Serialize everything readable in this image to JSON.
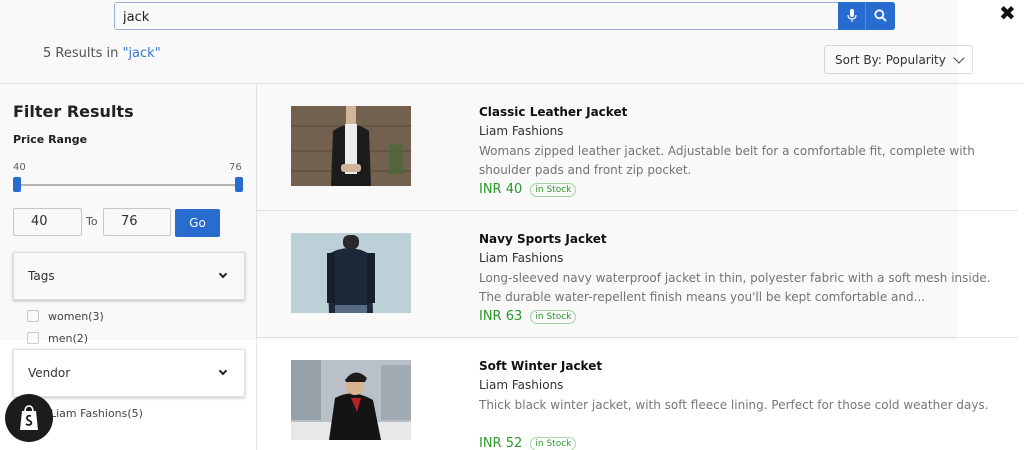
{
  "search": {
    "value": "jack",
    "mic_icon": "microphone-icon",
    "search_icon": "search-icon",
    "close_icon": "close-icon"
  },
  "results_summary": {
    "count_text": "5 Results in",
    "query_text": "\"jack\""
  },
  "sort": {
    "label": "Sort By: Popularity"
  },
  "filters": {
    "title": "Filter Results",
    "price_range": {
      "label": "Price Range",
      "min_label": "40",
      "max_label": "76",
      "min_value": "40",
      "max_value": "76",
      "to_label": "To",
      "go_label": "Go"
    },
    "tags": {
      "label": "Tags",
      "options": [
        {
          "label": "women(3)"
        },
        {
          "label": "men(2)"
        }
      ]
    },
    "vendor": {
      "label": "Vendor",
      "options": [
        {
          "label": "Liam Fashions(5)"
        }
      ]
    }
  },
  "products": [
    {
      "title": "Classic Leather Jacket",
      "vendor": "Liam Fashions",
      "description": "Womans zipped leather jacket. Adjustable belt for a comfortable fit, complete with shoulder pads and front zip pocket.",
      "price": "INR 40",
      "stock": "in Stock"
    },
    {
      "title": "Navy Sports Jacket",
      "vendor": "Liam Fashions",
      "description": "Long-sleeved navy waterproof jacket in thin, polyester fabric with a soft mesh inside. The durable water-repellent finish means you'll be kept comfortable and...",
      "price": "INR 63",
      "stock": "in Stock"
    },
    {
      "title": "Soft Winter Jacket",
      "vendor": "Liam Fashions",
      "description": "Thick black winter jacket, with soft fleece lining. Perfect for those cold weather days.",
      "price": "INR 52",
      "stock": "in Stock"
    }
  ],
  "colors": {
    "accent": "#2b6fd6",
    "price_green": "#2e9a2e",
    "query_blue": "#3a7fd5"
  }
}
